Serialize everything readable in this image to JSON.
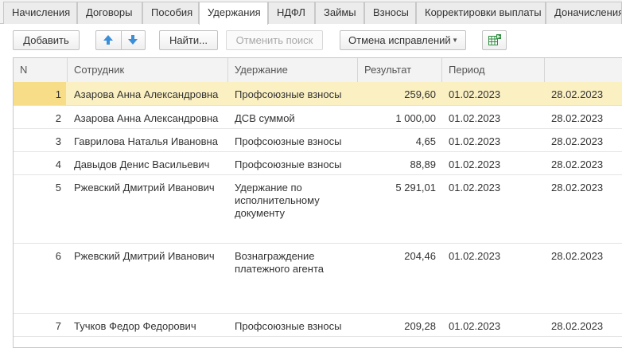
{
  "tabs": [
    {
      "label": "Начисления",
      "active": false
    },
    {
      "label": "Договоры",
      "active": false
    },
    {
      "label": "Пособия",
      "active": false
    },
    {
      "label": "Удержания",
      "active": true
    },
    {
      "label": "НДФЛ",
      "active": false
    },
    {
      "label": "Займы",
      "active": false
    },
    {
      "label": "Взносы",
      "active": false
    },
    {
      "label": "Корректировки выплаты",
      "active": false
    },
    {
      "label": "Доначисления",
      "active": false
    }
  ],
  "toolbar": {
    "add": "Добавить",
    "find": "Найти...",
    "cancel_search": "Отменить поиск",
    "corrections": "Отмена исправлений"
  },
  "colors": {
    "selected_row": "#fbf0c2",
    "selected_cell": "#f7dd88",
    "arrow_blue": "#3a8fd8",
    "excel_green": "#2e8b3e"
  },
  "table": {
    "headers": [
      "N",
      "Сотрудник",
      "Удержание",
      "Результат",
      "Период",
      ""
    ],
    "rows": [
      {
        "n": "1",
        "employee": "Азарова Анна Александровна",
        "deduction": "Профсоюзные взносы",
        "result": "259,60",
        "from": "01.02.2023",
        "to": "28.02.2023",
        "selected": true
      },
      {
        "n": "2",
        "employee": "Азарова Анна Александровна",
        "deduction": "ДСВ суммой",
        "result": "1 000,00",
        "from": "01.02.2023",
        "to": "28.02.2023"
      },
      {
        "n": "3",
        "employee": "Гаврилова Наталья Ивановна",
        "deduction": "Профсоюзные взносы",
        "result": "4,65",
        "from": "01.02.2023",
        "to": "28.02.2023"
      },
      {
        "n": "4",
        "employee": "Давыдов Денис Васильевич",
        "deduction": "Профсоюзные взносы",
        "result": "88,89",
        "from": "01.02.2023",
        "to": "28.02.2023"
      },
      {
        "n": "5",
        "employee": "Ржевский Дмитрий Иванович",
        "deduction": "Удержание по исполнительному документу",
        "result": "5 291,01",
        "from": "01.02.2023",
        "to": "28.02.2023"
      },
      {
        "n": "6",
        "employee": "Ржевский Дмитрий Иванович",
        "deduction": "Вознаграждение платежного агента",
        "result": "204,46",
        "from": "01.02.2023",
        "to": "28.02.2023"
      },
      {
        "n": "7",
        "employee": "Тучков Федор Федорович",
        "deduction": "Профсоюзные взносы",
        "result": "209,28",
        "from": "01.02.2023",
        "to": "28.02.2023"
      }
    ]
  }
}
